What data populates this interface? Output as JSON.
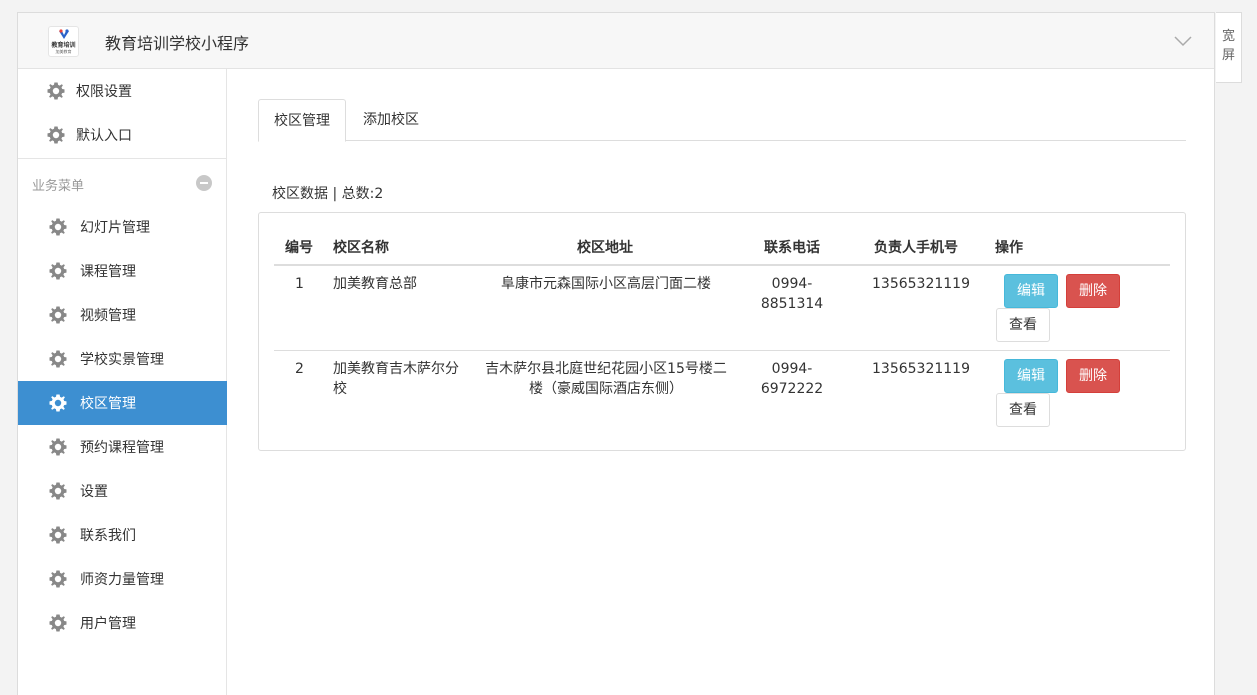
{
  "app": {
    "title": "教育培训学校小程序",
    "logo_text": "教育培训",
    "logo_subtext": "加美教育"
  },
  "side_toggle": {
    "label_line1": "宽",
    "label_line2": "屏"
  },
  "sidebar": {
    "top_items": [
      {
        "label": "权限设置",
        "icon": "gear-icon"
      },
      {
        "label": "默认入口",
        "icon": "gear-icon"
      }
    ],
    "group_label": "业务菜单",
    "items": [
      {
        "label": "幻灯片管理",
        "icon": "gear-icon"
      },
      {
        "label": "课程管理",
        "icon": "gear-icon"
      },
      {
        "label": "视频管理",
        "icon": "gear-icon"
      },
      {
        "label": "学校实景管理",
        "icon": "gear-icon"
      },
      {
        "label": "校区管理",
        "icon": "gear-icon",
        "active": true
      },
      {
        "label": "预约课程管理",
        "icon": "gear-icon"
      },
      {
        "label": "设置",
        "icon": "gear-icon"
      },
      {
        "label": "联系我们",
        "icon": "gear-icon"
      },
      {
        "label": "师资力量管理",
        "icon": "gear-icon"
      },
      {
        "label": "用户管理",
        "icon": "gear-icon"
      }
    ]
  },
  "tabs": [
    {
      "label": "校区管理",
      "active": true
    },
    {
      "label": "添加校区",
      "active": false
    }
  ],
  "data_header": "校区数据 | 总数:2",
  "table": {
    "columns": [
      "编号",
      "校区名称",
      "校区地址",
      "联系电话",
      "负责人手机号",
      "操作"
    ],
    "rows": [
      {
        "id": "1",
        "name": "加美教育总部",
        "address": "阜康市元森国际小区高层门面二楼",
        "phone_line1": "0994-",
        "phone_line2": "8851314",
        "mobile": "13565321119"
      },
      {
        "id": "2",
        "name_line1": "加美教育吉木萨尔分",
        "name_line2": "校",
        "address_line1": "吉木萨尔县北庭世纪花园小区15号楼二",
        "address_line2": "楼（豪威国际酒店东侧）",
        "phone_line1": "0994-",
        "phone_line2": "6972222",
        "mobile": "13565321119"
      }
    ],
    "actions": {
      "edit": "编辑",
      "delete": "删除",
      "view": "查看"
    }
  },
  "colors": {
    "active_nav": "#3d8fd1",
    "edit_button": "#5bc0de",
    "delete_button": "#d9534f"
  }
}
